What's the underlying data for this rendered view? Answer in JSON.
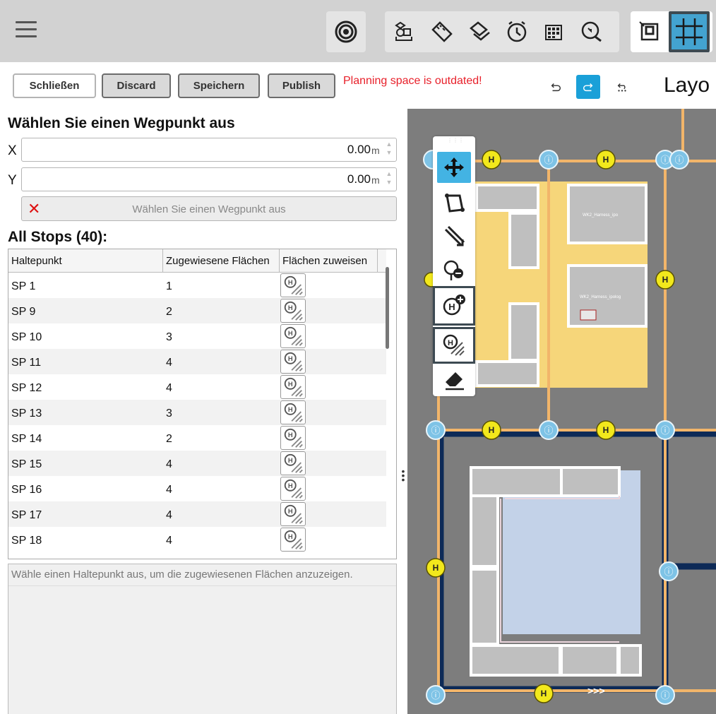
{
  "header": {
    "menu_icon": "hamburger-icon",
    "tools": [
      "radar-icon",
      "objects-icon",
      "ruler-icon",
      "layers-icon",
      "clock-icon",
      "grid-dots-icon",
      "search-zoom-icon",
      "frame-icon",
      "grid-icon"
    ]
  },
  "actions": {
    "close": "Schließen",
    "discard": "Discard",
    "save": "Speichern",
    "publish": "Publish",
    "warning": "Planning space is outdated!",
    "layout_label": "Layo"
  },
  "waypoint": {
    "title": "Wählen Sie einen Wegpunkt aus",
    "x_label": "X",
    "x_value": "0.00",
    "y_label": "Y",
    "y_value": "0.00",
    "unit": "m",
    "select_button": "Wählen Sie einen Wegpunkt aus"
  },
  "stops": {
    "title": "All Stops (40):",
    "columns": [
      "Haltepunkt",
      "Zugewiesene Flächen",
      "Flächen zuweisen"
    ],
    "rows": [
      {
        "name": "SP 1",
        "count": "1"
      },
      {
        "name": "SP 9",
        "count": "2"
      },
      {
        "name": "SP 10",
        "count": "3"
      },
      {
        "name": "SP 11",
        "count": "4"
      },
      {
        "name": "SP 12",
        "count": "4"
      },
      {
        "name": "SP 13",
        "count": "3"
      },
      {
        "name": "SP 14",
        "count": "2"
      },
      {
        "name": "SP 15",
        "count": "4"
      },
      {
        "name": "SP 16",
        "count": "4"
      },
      {
        "name": "SP 17",
        "count": "4"
      },
      {
        "name": "SP 18",
        "count": "4"
      }
    ]
  },
  "info": {
    "hint": "Wähle einen Haltepunkt aus, um die zugewiesenen Flächen anzuzeigen."
  },
  "canvas": {
    "areas": [
      "WK2_Harness_ipo",
      "WK2_Harness_ipolog"
    ],
    "colors": {
      "path": "#f2b56a",
      "lane": "#0d2a57",
      "hold": "#f2e81c",
      "waypoint": "#7ec3e6",
      "zone_yellow": "#f6d67a",
      "zone_blue": "#c3d2e8",
      "block": "#bfbfbf"
    }
  }
}
